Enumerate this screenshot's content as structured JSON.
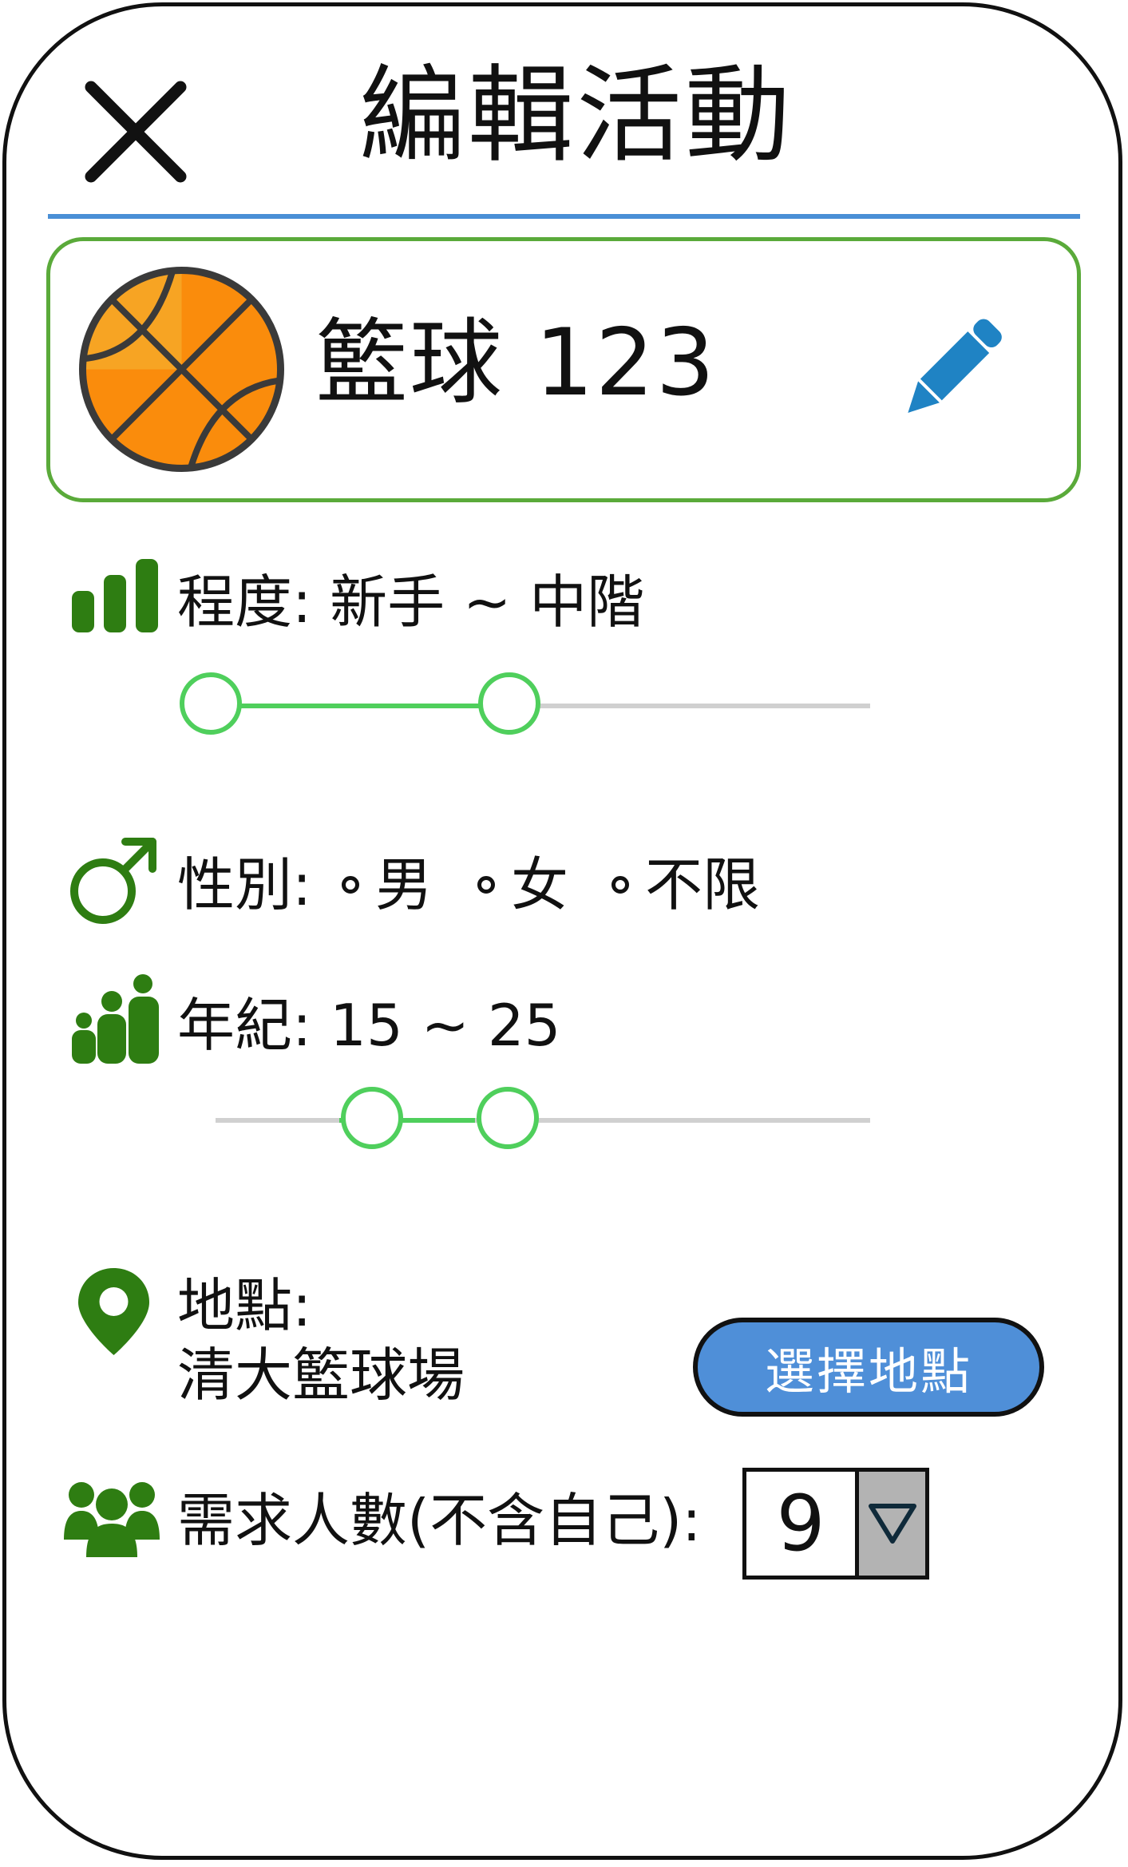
{
  "header": {
    "title": "編輯活動"
  },
  "activity": {
    "name": "籃球 123"
  },
  "level": {
    "label": "程度: 新手 ~ 中階",
    "range": [
      0,
      0.5
    ]
  },
  "gender": {
    "label": "性別:",
    "options": [
      {
        "label": "男"
      },
      {
        "label": "女"
      },
      {
        "label": "不限"
      }
    ]
  },
  "age": {
    "label": "年紀: 15 ~ 25",
    "min": 15,
    "max": 25
  },
  "location": {
    "label": "地點:",
    "value": "清大籃球場",
    "button_label": "選擇地點"
  },
  "people": {
    "label": "需求人數(不含自己):",
    "value": "9"
  },
  "colors": {
    "accent_green": "#2e7d12",
    "slider_green": "#4fcf5c",
    "button_blue": "#4f8fd8",
    "divider_blue": "#4a8fd6",
    "card_border": "#5aaa3a"
  }
}
